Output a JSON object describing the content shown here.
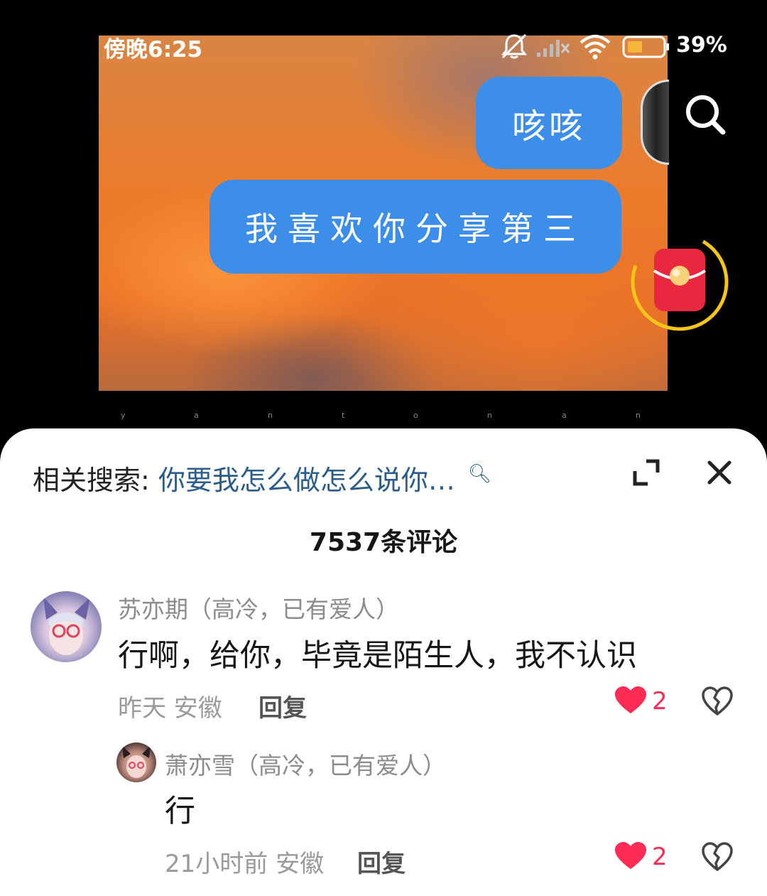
{
  "status_bar": {
    "time": "傍晚6:25",
    "battery_percent": "39%",
    "icons": [
      "bell-muted-icon",
      "signal-off-icon",
      "wifi-icon",
      "battery-icon"
    ]
  },
  "video": {
    "bubble_small": "咳咳",
    "bubble_large": "我喜欢你分享第三",
    "bubble_color": "#3d8ee8"
  },
  "watermark_letters": [
    "y",
    "a",
    "n",
    "t",
    "o",
    "n",
    "a",
    "n"
  ],
  "panel": {
    "related_label": "相关搜索:",
    "related_query": "你要我怎么做怎么说你…",
    "comment_count": "7537条评论"
  },
  "comments": [
    {
      "user": "苏亦期（高冷，已有爱人）",
      "text": "行啊，给你，毕竟是陌生人，我不认识",
      "meta": "昨天 安徽",
      "reply_label": "回复",
      "likes": "2"
    },
    {
      "user": "萧亦雪（高冷，已有爱人）",
      "text": "行",
      "meta": "21小时前 安徽",
      "reply_label": "回复",
      "likes": "2"
    }
  ],
  "colors": {
    "like": "#fe2c55",
    "link": "#2b5d8c",
    "redpacket_ring": "#f5c518"
  }
}
